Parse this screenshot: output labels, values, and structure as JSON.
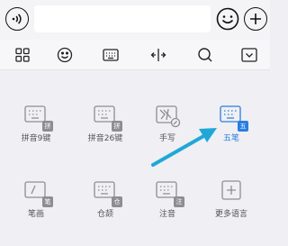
{
  "topbar": {
    "input_value": "",
    "icons": [
      "voice-icon",
      "emoji-icon",
      "plus-icon"
    ]
  },
  "toolbar": {
    "icons": [
      "grid-menu-icon",
      "emoji-icon",
      "keyboard-icon",
      "cursor-move-icon",
      "search-icon",
      "collapse-keyboard-icon"
    ]
  },
  "input_methods": [
    {
      "label": "拼音9键",
      "badge": "拼",
      "selected": false
    },
    {
      "label": "拼音26键",
      "badge": "拼",
      "selected": false
    },
    {
      "label": "手写",
      "badge": "",
      "selected": false
    },
    {
      "label": "五笔",
      "badge": "五",
      "selected": true
    },
    {
      "label": "笔画",
      "badge": "笔",
      "selected": false
    },
    {
      "label": "仓颉",
      "badge": "仓",
      "selected": false
    },
    {
      "label": "注音",
      "badge": "注",
      "selected": false
    },
    {
      "label": "更多语言",
      "badge": "",
      "selected": false
    }
  ],
  "colors": {
    "accent": "#2a7ee0",
    "arrow": "#1fa8d6",
    "icon_gray": "#8d8d92"
  }
}
